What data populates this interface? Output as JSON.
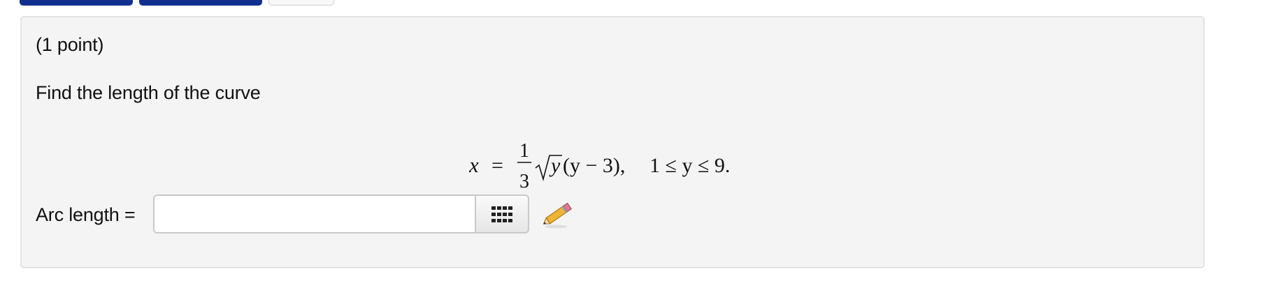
{
  "tabs": [
    {
      "style": "primary",
      "color": "#102f8e"
    },
    {
      "style": "primary",
      "color": "#102f8e"
    },
    {
      "style": "default",
      "color": "#f8f8f8"
    }
  ],
  "problem": {
    "points": "(1 point)",
    "prompt": "Find the length of the curve",
    "formula": {
      "lhs": "x",
      "equals": "=",
      "frac_num": "1",
      "frac_den": "3",
      "radicand": "y",
      "factor": "(y − 3),",
      "range": "1 ≤ y ≤ 9."
    },
    "answer_label": "Arc length =",
    "answer_value": "",
    "matrix_icon": "grid-icon",
    "pencil_icon": "pencil-icon"
  },
  "colors": {
    "panel_bg": "#f4f4f4",
    "tab_blue": "#102f8e",
    "pencil_body": "#f0b434"
  }
}
